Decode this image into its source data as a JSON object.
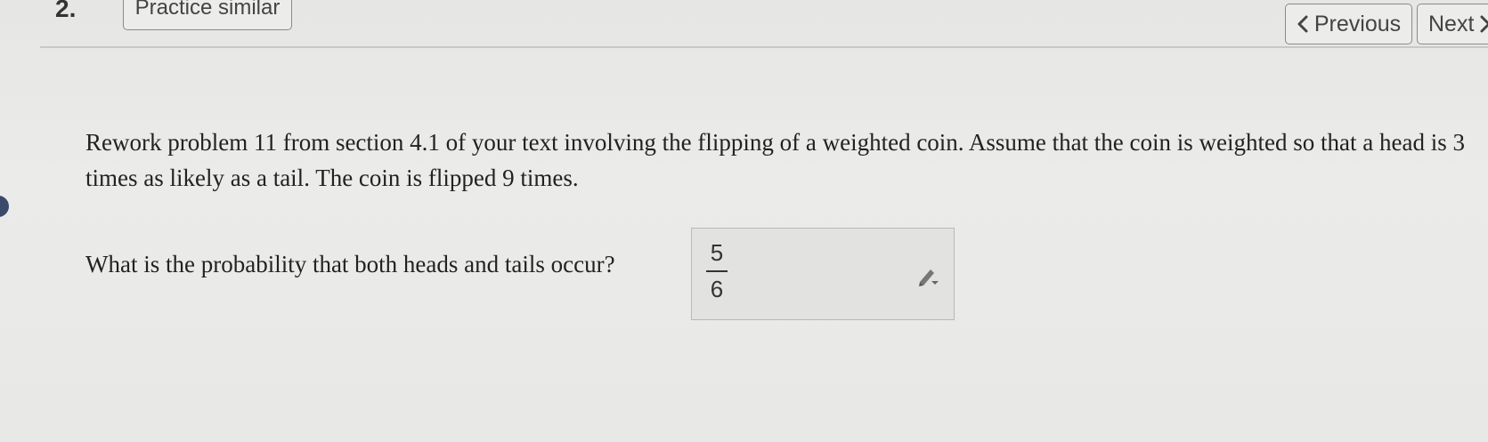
{
  "header": {
    "problem_number": "2.",
    "practice_label": "Practice similar",
    "previous_label": "Previous",
    "next_label": "Next"
  },
  "problem": {
    "text": "Rework problem 11 from section 4.1 of your text involving the flipping of a weighted coin. Assume that the coin is weighted so that a head is 3 times as likely as a tail. The coin is flipped 9 times.",
    "question": "What is the probability that both heads and tails occur?",
    "answer": {
      "numerator": "5",
      "denominator": "6"
    }
  },
  "icons": {
    "previous": "chevron-left-icon",
    "next": "chevron-right-icon",
    "edit": "pencil-edit-icon"
  },
  "colors": {
    "background": "#e9e9e7",
    "button_border": "#8a8a8a",
    "text": "#222222",
    "marker": "#3b4a6b"
  }
}
